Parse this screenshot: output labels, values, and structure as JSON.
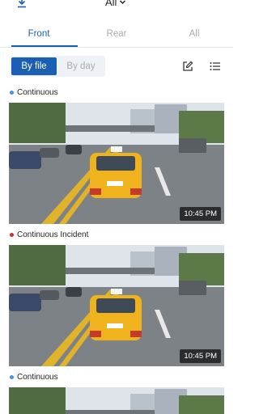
{
  "header": {
    "filter_label": "All",
    "download_icon": "download-icon",
    "chevron_icon": "chevron-down-icon"
  },
  "tabs": [
    {
      "label": "Front",
      "active": true
    },
    {
      "label": "Rear",
      "active": false
    },
    {
      "label": "All",
      "active": false
    }
  ],
  "view_toggle": {
    "by_file": "By file",
    "by_day": "By day",
    "selected": "By file"
  },
  "toolbar": {
    "edit_icon": "edit-icon",
    "list_icon": "list-icon"
  },
  "colors": {
    "accent": "#1a5fb4",
    "continuous_dot": "#4a90e2",
    "incident_dot": "#d32f2f"
  },
  "recordings": [
    {
      "type": "Continuous",
      "time": "10:45 PM",
      "dot": "#4a90e2"
    },
    {
      "type": "Continuous Incident",
      "time": "10:45 PM",
      "dot": "#d32f2f"
    },
    {
      "type": "Continuous",
      "time": "",
      "dot": "#4a90e2"
    }
  ]
}
